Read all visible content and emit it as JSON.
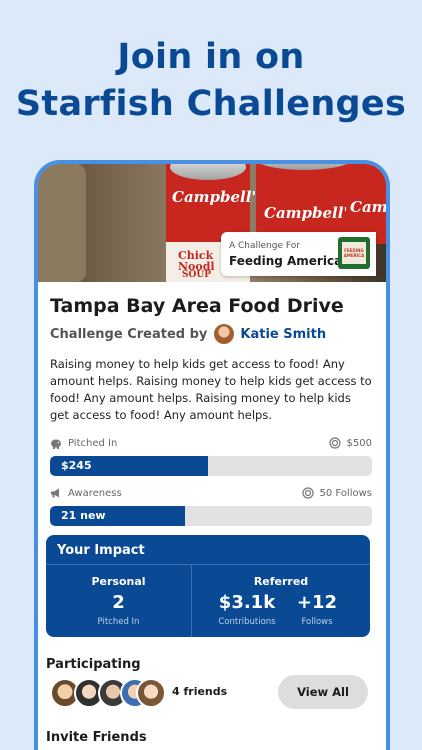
{
  "promo": {
    "line1": "Join in on",
    "line2": "Starfish Challenges"
  },
  "hero": {
    "can_text": "Campbell's",
    "can_text_partial": "Chick Noodl",
    "can_text_bottom": "SOUP",
    "challenge_for_label": "A Challenge For",
    "charity_name": "Feeding America",
    "charity_logo_text": "FEEDING AMERICA",
    "charity_logo_icon": "feeding-america-logo"
  },
  "challenge": {
    "title": "Tampa Bay Area Food Drive",
    "created_by_label": "Challenge Created by",
    "creator_name": "Katie Smith",
    "description": "Raising money to help kids get access to food! Any amount helps. Raising money to help kids get access to food! Any amount helps. Raising money to help kids get access to food! Any amount helps."
  },
  "pitched_in": {
    "label": "Pitched In",
    "goal": "$500",
    "value_label": "$245",
    "progress": 0.49
  },
  "awareness": {
    "label": "Awareness",
    "goal": "50 Follows",
    "value_label": "21 new",
    "progress": 0.42
  },
  "impact": {
    "title": "Your Impact",
    "personal": {
      "label": "Personal",
      "value": "2",
      "caption": "Pitched In"
    },
    "referred": {
      "label": "Referred",
      "contributions_value": "$3.1k",
      "contributions_caption": "Contributions",
      "follows_value": "+12",
      "follows_caption": "Follows"
    }
  },
  "participating": {
    "label": "Participating",
    "count_text": "4 friends",
    "view_all_label": "View All"
  },
  "invite": {
    "label": "Invite Friends"
  },
  "colors": {
    "background": "#dbe9f9",
    "brand_blue": "#0a4a94",
    "phone_border": "#4a90e2",
    "bar_track": "#e2e2e2"
  }
}
